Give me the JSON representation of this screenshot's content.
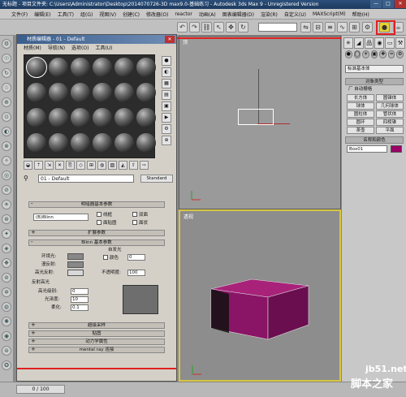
{
  "window": {
    "title": "无标题    - 项目文件夹: C:\\Users\\Administrator\\Desktop\\2014070726-3D max9.0-基础练习  - Autodesk 3ds Max 9  - Unregistered Version",
    "min": "—",
    "max": "□",
    "close": "✕"
  },
  "menubar": [
    "文件(F)",
    "编辑(E)",
    "工具(T)",
    "组(G)",
    "视图(V)",
    "创建(C)",
    "修改器(O)",
    "reactor",
    "动画(A)",
    "图表编辑器(D)",
    "渲染(R)",
    "自定义(U)",
    "MAXScript(M)",
    "帮助(H)"
  ],
  "toolbar": {
    "selection_set": "",
    "highlight_color": "#e02020"
  },
  "viewports": {
    "top_label": "顶",
    "persp_label": "透视"
  },
  "command_panel": {
    "tabs": [
      "✳",
      "◢",
      "品",
      "◉",
      "▭",
      "⚒"
    ],
    "category_dropdown": "标准基本体",
    "object_type_header": "对象类型",
    "autogrid": "厂 自动栅格",
    "buttons": [
      "长方体",
      "圆锥体",
      "球体",
      "几何球体",
      "圆柱体",
      "管状体",
      "圆环",
      "四棱锥",
      "茶壶",
      "平面"
    ],
    "name_color_header": "名称和颜色",
    "object_name": "Box01",
    "object_color": "#990066"
  },
  "status": {
    "time": "0 / 100"
  },
  "material_editor": {
    "title": "材质编辑器 - 01 - Default",
    "close": "✕",
    "menu": [
      "材质(M)",
      "导航(N)",
      "选项(O)",
      "工具(U)"
    ],
    "material_name": "01 - Default",
    "material_type": "Standard",
    "rollouts": {
      "shader_basic": "明暗器基本参数",
      "extended": "扩展参数",
      "blinn_basic": "Blinn 基本参数",
      "supersampling": "超级采样",
      "maps": "贴图",
      "dynamics": "动力学属性",
      "mental_ray": "mental ray 连接"
    },
    "shader": "(B)Blinn",
    "checks": {
      "wire": "线框",
      "two_sided": "双面",
      "face_map": "面贴图",
      "faceted": "面状"
    },
    "labels": {
      "self_illum": "自发光",
      "color": "颜色",
      "ambient": "环境光:",
      "diffuse": "漫反射:",
      "specular": "高光反射:",
      "opacity": "不透明度:",
      "spec_highlights": "反射高光",
      "spec_level": "高光级别:",
      "glossiness": "光泽度:",
      "soften": "柔化:"
    },
    "values": {
      "self_illum": "0",
      "opacity": "100",
      "spec_level": "0",
      "glossiness": "10",
      "soften": "0.1"
    }
  },
  "watermark": {
    "line1": "jb51.net",
    "line2": "脚本之家"
  }
}
